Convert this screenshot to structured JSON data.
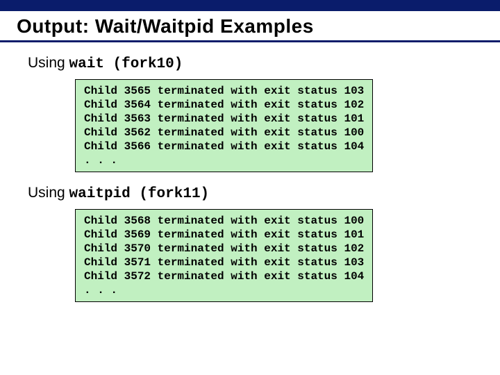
{
  "title": "Output: Wait/Waitpid Examples",
  "section1": {
    "label_plain": "Using ",
    "label_mono": "wait (fork10)"
  },
  "section2": {
    "label_plain": "Using ",
    "label_mono": "waitpid (fork11)"
  },
  "code1_lines": [
    "Child 3565 terminated with exit status 103",
    "Child 3564 terminated with exit status 102",
    "Child 3563 terminated with exit status 101",
    "Child 3562 terminated with exit status 100",
    "Child 3566 terminated with exit status 104",
    ". . ."
  ],
  "code2_lines": [
    "Child 3568 terminated with exit status 100",
    "Child 3569 terminated with exit status 101",
    "Child 3570 terminated with exit status 102",
    "Child 3571 terminated with exit status 103",
    "Child 3572 terminated with exit status 104",
    ". . ."
  ]
}
